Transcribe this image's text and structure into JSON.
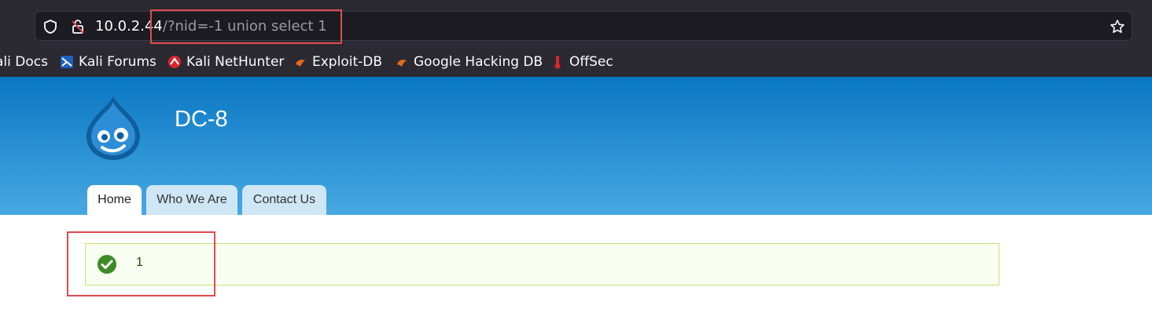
{
  "browser": {
    "url_host": "10.0.2.44",
    "url_path": "/?nid=-1 union select 1",
    "icons": [
      "shield-icon",
      "lock-icon",
      "star-icon"
    ],
    "bookmarks": [
      {
        "label": "ali Docs",
        "icon": "kali-docs-icon"
      },
      {
        "label": "Kali Forums",
        "icon": "kali-forums-icon"
      },
      {
        "label": "Kali NetHunter",
        "icon": "kali-nethunter-icon"
      },
      {
        "label": "Exploit-DB",
        "icon": "exploit-db-icon"
      },
      {
        "label": "Google Hacking DB",
        "icon": "google-hacking-db-icon"
      },
      {
        "label": "OffSec",
        "icon": "offsec-icon"
      }
    ]
  },
  "site": {
    "name": "DC-8",
    "logo_icon": "drupal-logo-icon",
    "tabs": [
      {
        "label": "Home",
        "active": true
      },
      {
        "label": "Who We Are",
        "active": false
      },
      {
        "label": "Contact Us",
        "active": false
      }
    ]
  },
  "message": {
    "icon": "check-circle-icon",
    "text": "1"
  },
  "colors": {
    "browser_bg": "#2b2a33",
    "header_top": "#0a77c3",
    "header_bottom": "#47a9e2",
    "highlight": "#e04a4f",
    "status_ok": "#3d8b27",
    "message_bg": "#f8fff0"
  }
}
